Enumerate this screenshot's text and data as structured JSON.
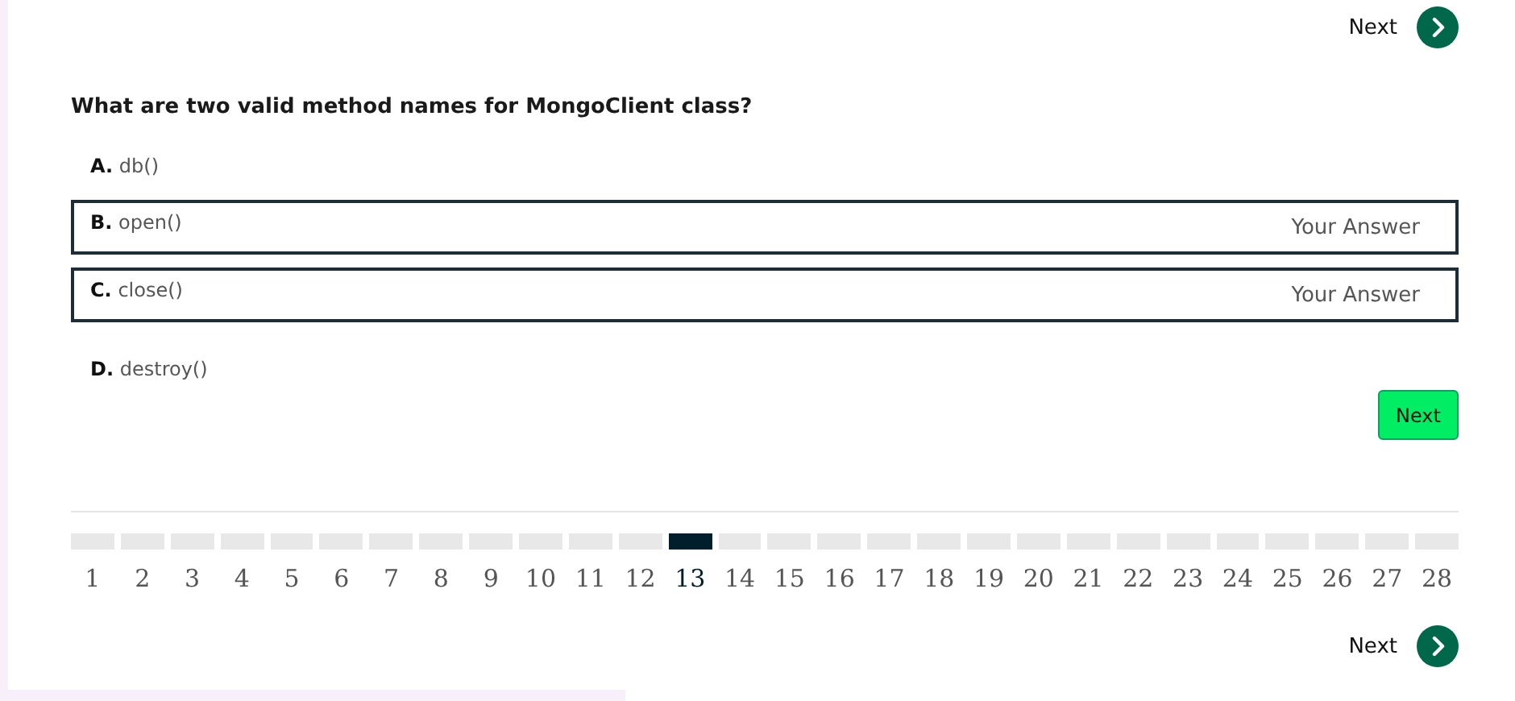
{
  "top_nav": {
    "label": "Next"
  },
  "question": "What are two valid method names for MongoClient class?",
  "options": [
    {
      "letter": "A.",
      "text": "db()",
      "selected": false
    },
    {
      "letter": "B.",
      "text": "open()",
      "selected": true,
      "tag": "Your Answer"
    },
    {
      "letter": "C.",
      "text": "close()",
      "selected": true,
      "tag": "Your Answer"
    },
    {
      "letter": "D.",
      "text": "destroy()",
      "selected": false
    }
  ],
  "submit_button": "Next",
  "pager": [
    {
      "number": "1",
      "selected": false
    },
    {
      "number": "2",
      "selected": false
    },
    {
      "number": "3",
      "selected": false
    },
    {
      "number": "4",
      "selected": false
    },
    {
      "number": "5",
      "selected": false
    },
    {
      "number": "6",
      "selected": false
    },
    {
      "number": "7",
      "selected": false
    },
    {
      "number": "8",
      "selected": false
    },
    {
      "number": "9",
      "selected": false
    },
    {
      "number": "10",
      "selected": false
    },
    {
      "number": "11",
      "selected": false
    },
    {
      "number": "12",
      "selected": false
    },
    {
      "number": "13",
      "selected": true
    },
    {
      "number": "14",
      "selected": false
    },
    {
      "number": "15",
      "selected": false
    },
    {
      "number": "16",
      "selected": false
    },
    {
      "number": "17",
      "selected": false
    },
    {
      "number": "18",
      "selected": false
    },
    {
      "number": "19",
      "selected": false
    },
    {
      "number": "20",
      "selected": false
    },
    {
      "number": "21",
      "selected": false
    },
    {
      "number": "22",
      "selected": false
    },
    {
      "number": "23",
      "selected": false
    },
    {
      "number": "24",
      "selected": false
    },
    {
      "number": "25",
      "selected": false
    },
    {
      "number": "26",
      "selected": false
    },
    {
      "number": "27",
      "selected": false
    },
    {
      "number": "28",
      "selected": false
    }
  ],
  "bottom_nav": {
    "label": "Next"
  }
}
